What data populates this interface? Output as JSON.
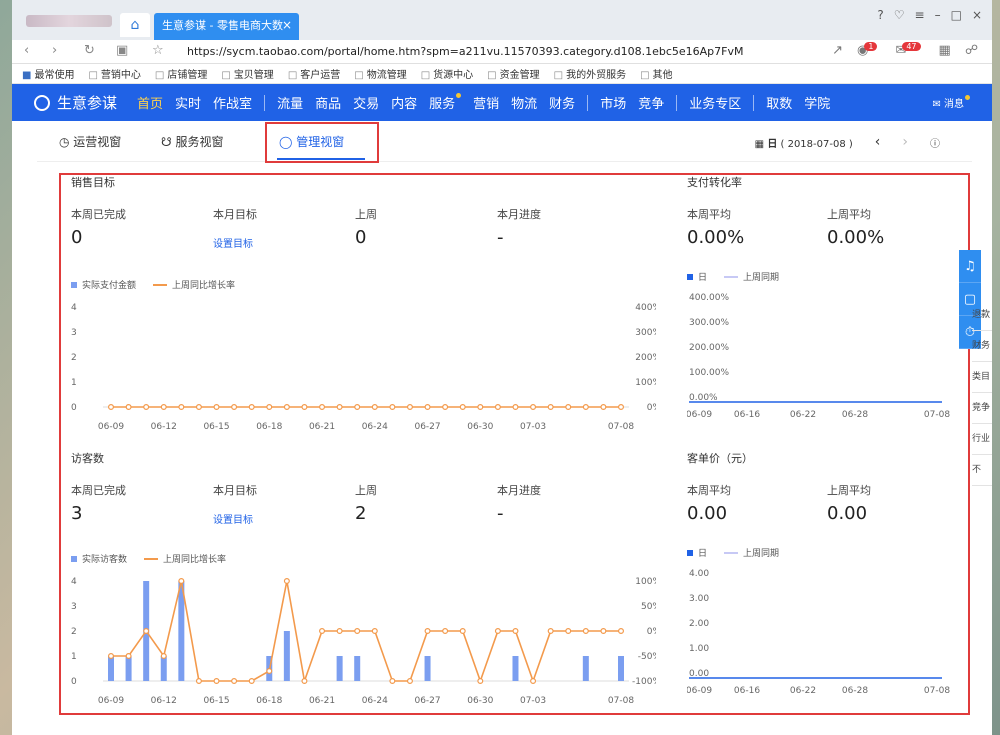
{
  "browser": {
    "active_tab_title": "生意参谋 - 零售电商大数",
    "url": "https://sycm.taobao.com/portal/home.htm?spm=a211vu.11570393.category.d108.1ebc5e16Ap7FvM",
    "notif_badge": "1",
    "mail_badge": "47",
    "bookmarks": [
      "最常使用",
      "营销中心",
      "店铺管理",
      "宝贝管理",
      "客户运营",
      "物流管理",
      "货源中心",
      "资金管理",
      "我的外贸服务",
      "其他"
    ]
  },
  "appnav": {
    "logo": "生意参谋",
    "items": [
      "首页",
      "实时",
      "作战室",
      "流量",
      "商品",
      "交易",
      "内容",
      "服务",
      "营销",
      "物流",
      "财务",
      "市场",
      "竞争",
      "业务专区",
      "取数",
      "学院"
    ],
    "message": "消息"
  },
  "subtabs": {
    "items": [
      "运营视窗",
      "服务视窗",
      "管理视窗"
    ],
    "date_label": "日",
    "date_value": "( 2018-07-08 )"
  },
  "sales": {
    "title": "销售目标",
    "labels": [
      "本周已完成",
      "本月目标",
      "上周",
      "本月进度"
    ],
    "values": [
      "0",
      "",
      "0",
      "-"
    ],
    "set_link": "设置目标",
    "legend_bar": "实际支付金额",
    "legend_line": "上周同比增长率"
  },
  "conversion": {
    "title": "支付转化率",
    "labels": [
      "本周平均",
      "上周平均"
    ],
    "values": [
      "0.00%",
      "0.00%"
    ],
    "legend_day": "日",
    "legend_prev": "上周同期"
  },
  "visitors": {
    "title": "访客数",
    "labels": [
      "本周已完成",
      "本月目标",
      "上周",
      "本月进度"
    ],
    "values": [
      "3",
      "",
      "2",
      "-"
    ],
    "set_link": "设置目标",
    "legend_bar": "实际访客数",
    "legend_line": "上周同比增长率"
  },
  "unitprice": {
    "title": "客单价（元）",
    "labels": [
      "本周平均",
      "上周平均"
    ],
    "values": [
      "0.00",
      "0.00"
    ],
    "legend_day": "日",
    "legend_prev": "上周同期"
  },
  "sidepanel": [
    "退款",
    "财务",
    "类目",
    "竞争",
    "行业",
    "不"
  ],
  "chart_data": [
    {
      "type": "bar",
      "name": "sales-chart",
      "categories": [
        "06-09",
        "06-10",
        "06-11",
        "06-12",
        "06-13",
        "06-14",
        "06-15",
        "06-16",
        "06-17",
        "06-18",
        "06-19",
        "06-20",
        "06-21",
        "06-22",
        "06-23",
        "06-24",
        "06-25",
        "06-26",
        "06-27",
        "06-28",
        "06-29",
        "06-30",
        "07-01",
        "07-02",
        "07-03",
        "07-04",
        "07-05",
        "07-06",
        "07-07",
        "07-08"
      ],
      "tick_labels": [
        "06-09",
        "06-12",
        "06-15",
        "06-18",
        "06-21",
        "06-24",
        "06-27",
        "06-30",
        "07-03",
        "07-08"
      ],
      "series": [
        {
          "name": "实际支付金额",
          "type": "bar",
          "values": [
            0,
            0,
            0,
            0,
            0,
            0,
            0,
            0,
            0,
            0,
            0,
            0,
            0,
            0,
            0,
            0,
            0,
            0,
            0,
            0,
            0,
            0,
            0,
            0,
            0,
            0,
            0,
            0,
            0,
            0
          ]
        },
        {
          "name": "上周同比增长率",
          "type": "line",
          "axis": "right",
          "values": [
            0,
            0,
            0,
            0,
            0,
            0,
            0,
            0,
            0,
            0,
            0,
            0,
            0,
            0,
            0,
            0,
            0,
            0,
            0,
            0,
            0,
            0,
            0,
            0,
            0,
            0,
            0,
            0,
            0,
            0
          ]
        }
      ],
      "ylim": [
        0,
        4
      ],
      "yticks": [
        "0",
        "1",
        "2",
        "3",
        "4"
      ],
      "y2lim": [
        0,
        400
      ],
      "y2ticks": [
        "0%",
        "100%",
        "200%",
        "300%",
        "400%"
      ]
    },
    {
      "type": "line",
      "name": "conversion-chart",
      "x_labels": [
        "06-09",
        "06-16",
        "06-22",
        "06-28",
        "07-08"
      ],
      "series": [
        {
          "name": "日",
          "values": [
            0,
            0,
            0,
            0,
            0,
            0,
            0,
            0,
            0,
            0,
            0,
            0,
            0,
            0,
            0,
            0,
            0,
            0,
            0,
            0,
            0,
            0,
            0,
            0,
            0,
            0,
            0,
            0,
            0,
            0
          ]
        }
      ],
      "ylim": [
        0,
        400
      ],
      "yticks": [
        "0.00%",
        "100.00%",
        "200.00%",
        "300.00%",
        "400.00%"
      ]
    },
    {
      "type": "bar",
      "name": "visitors-chart",
      "categories": [
        "06-09",
        "06-10",
        "06-11",
        "06-12",
        "06-13",
        "06-14",
        "06-15",
        "06-16",
        "06-17",
        "06-18",
        "06-19",
        "06-20",
        "06-21",
        "06-22",
        "06-23",
        "06-24",
        "06-25",
        "06-26",
        "06-27",
        "06-28",
        "06-29",
        "06-30",
        "07-01",
        "07-02",
        "07-03",
        "07-04",
        "07-05",
        "07-06",
        "07-07",
        "07-08"
      ],
      "tick_labels": [
        "06-09",
        "06-12",
        "06-15",
        "06-18",
        "06-21",
        "06-24",
        "06-27",
        "06-30",
        "07-03",
        "07-08"
      ],
      "series": [
        {
          "name": "实际访客数",
          "type": "bar",
          "values": [
            1,
            1,
            4,
            1,
            4,
            0,
            0,
            0,
            0,
            1,
            2,
            0,
            0,
            1,
            1,
            0,
            0,
            0,
            1,
            0,
            0,
            0,
            0,
            1,
            0,
            0,
            0,
            1,
            0,
            1
          ]
        },
        {
          "name": "上周同比增长率",
          "type": "line",
          "axis": "right",
          "values": [
            -50,
            -50,
            0,
            -50,
            100,
            -100,
            -100,
            -100,
            -100,
            -80,
            100,
            -100,
            0,
            0,
            0,
            0,
            -100,
            -100,
            0,
            0,
            0,
            -100,
            0,
            0,
            -100,
            0,
            0,
            0,
            0,
            0
          ]
        }
      ],
      "ylim": [
        0,
        4
      ],
      "yticks": [
        "0",
        "1",
        "2",
        "3",
        "4"
      ],
      "y2lim": [
        -100,
        100
      ],
      "y2ticks": [
        "-100%",
        "-50%",
        "0%",
        "50%",
        "100%"
      ]
    },
    {
      "type": "line",
      "name": "unitprice-chart",
      "x_labels": [
        "06-09",
        "06-16",
        "06-22",
        "06-28",
        "07-08"
      ],
      "series": [
        {
          "name": "日",
          "values": [
            0,
            0,
            0,
            0,
            0,
            0,
            0,
            0,
            0,
            0,
            0,
            0,
            0,
            0,
            0,
            0,
            0,
            0,
            0,
            0,
            0,
            0,
            0,
            0,
            0,
            0,
            0,
            0,
            0,
            0
          ]
        }
      ],
      "ylim": [
        0,
        4
      ],
      "yticks": [
        "0.00",
        "1.00",
        "2.00",
        "3.00",
        "4.00"
      ]
    }
  ],
  "colors": {
    "brand": "#2062e6",
    "bar": "#7b9ef0",
    "line": "#f39a4c",
    "highlight": "#e03b3b"
  }
}
